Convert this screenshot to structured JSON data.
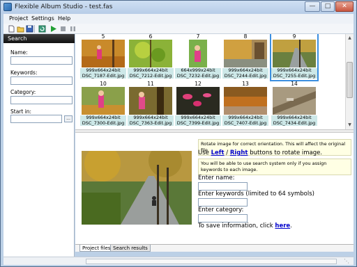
{
  "window": {
    "title": "Flexible Album Studio - test.fas"
  },
  "menu": [
    {
      "label": "Project"
    },
    {
      "label": "Settings"
    },
    {
      "label": "Help"
    }
  ],
  "toolbar": {
    "buttons": [
      "new-icon",
      "open-icon",
      "save-icon",
      "refresh-icon",
      "play-icon",
      "stop-icon",
      "pause-icon"
    ]
  },
  "search": {
    "header": "Search",
    "name_label": "Name:",
    "keywords_label": "Keywords:",
    "category_label": "Category:",
    "startin_label": "Start in:",
    "name_value": "",
    "keywords_value": "",
    "category_value": "",
    "startin_value": "",
    "browse_label": "..."
  },
  "thumbnails": [
    {
      "num": "5",
      "info": "999x664x24bit",
      "file": "DSC_7187-Edit.jpg",
      "selected": false
    },
    {
      "num": "6",
      "info": "999x664x24bit",
      "file": "DSC_7212-Edit.jpg",
      "selected": false
    },
    {
      "num": "7",
      "info": "664x999x24bit",
      "file": "DSC_7232-Edit.jpg",
      "selected": false
    },
    {
      "num": "8",
      "info": "999x664x24bit",
      "file": "DSC_7244-Edit.jpg",
      "selected": false
    },
    {
      "num": "9",
      "info": "999x664x24bit",
      "file": "DSC_7255-Edit.jpg",
      "selected": true
    },
    {
      "num": "10",
      "info": "999x664x24bit",
      "file": "DSC_7300-Edit.jpg",
      "selected": false
    },
    {
      "num": "11",
      "info": "999x664x24bit",
      "file": "DSC_7363-Edit.jpg",
      "selected": false
    },
    {
      "num": "12",
      "info": "999x664x24bit",
      "file": "DSC_7399-Edit.jpg",
      "selected": false
    },
    {
      "num": "13",
      "info": "999x664x24bit",
      "file": "DSC_7407-Edit.jpg",
      "selected": false
    },
    {
      "num": "14",
      "info": "999x664x24bit",
      "file": "DSC_7434-Edit.jpg",
      "selected": false
    }
  ],
  "details": {
    "note_rotate": "Rotate image for correct orientation.  This will affect the original file.",
    "use_text": "Use",
    "left_link": "Left",
    "slash": "/",
    "right_link": "Right",
    "rotate_suffix": "buttons to rotate image.",
    "note_keywords": "You will be able to use search system only if you assign keywords to each image.",
    "enter_name": "Enter name:",
    "enter_keywords": "Enter keywords (limited to 64 symbols)",
    "enter_category": "Enter category:",
    "save_prefix": "To save information, click",
    "save_link": "here",
    "save_suffix": ".",
    "name_value": "",
    "keywords_value": "",
    "category_value": ""
  },
  "tabs": [
    {
      "label": "Project files",
      "active": true
    },
    {
      "label": "Search results",
      "active": false
    }
  ],
  "colors": {
    "accent": "#3c8fe0",
    "caption_bg": "#cde8e8",
    "link": "#0000cc",
    "note_bg": "#ffffe4"
  }
}
